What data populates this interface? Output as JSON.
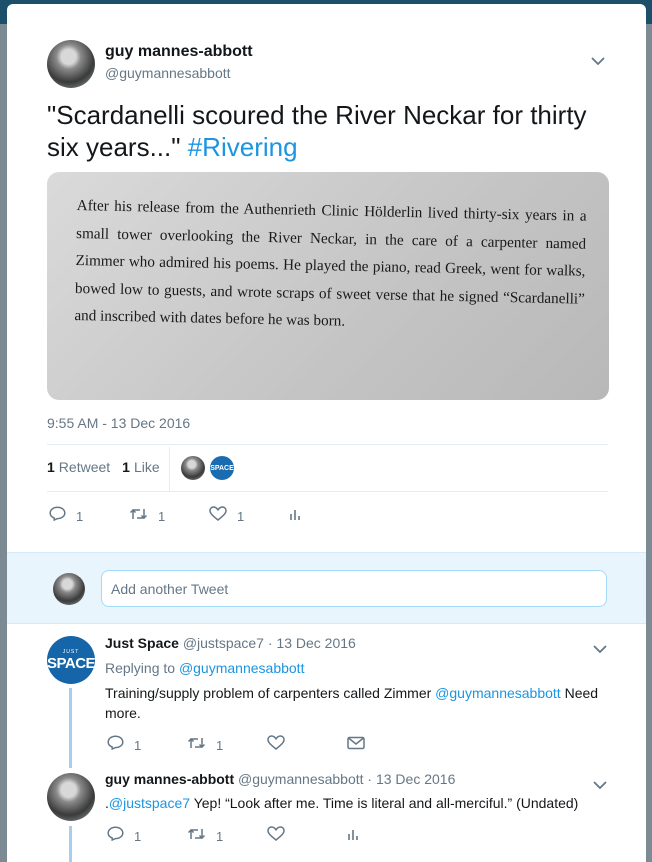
{
  "tweet": {
    "author_name": "guy mannes-abbott",
    "author_handle": "@guymannesabbott",
    "text": "\"Scardanelli scoured the River Neckar for thirty six years...\"",
    "hashtag": "#Rivering",
    "photo_text": "After his release from the Authenrieth Clinic Hölderlin lived thirty-six years in a small tower overlooking the River Neckar, in the care of a carpenter named Zimmer who admired his poems. He played the piano, read Greek, went for walks, bowed low to guests, and wrote scraps of sweet verse that he signed “Scardanelli” and inscribed with dates before he was born.",
    "timestamp": "9:55 AM - 13 Dec 2016",
    "retweet_count": "1",
    "retweet_label": "Retweet",
    "like_count": "1",
    "like_label": "Like",
    "reply_count": "1",
    "rt_action_count": "1",
    "like_action_count": "1",
    "liker_badge": "SPACE"
  },
  "reply_input": {
    "placeholder": "Add another Tweet"
  },
  "replies": [
    {
      "name": "Just Space",
      "handle": "@justspace7",
      "date": "· 13 Dec 2016",
      "replying_prefix": "Replying to",
      "replying_to": "@guymannesabbott",
      "text_before": "Training/supply problem of carpenters called Zimmer",
      "mention": "@guymannesabbott",
      "text_after": "Need",
      "text_line2": "more.",
      "reply_count": "1",
      "retweet_count": "1",
      "avatar_small": "JUST",
      "avatar_big": "SPACE"
    },
    {
      "name": "guy mannes-abbott",
      "handle": "@guymannesabbott",
      "date": "· 13 Dec 2016",
      "prefix": ".",
      "mention": "@justspace7",
      "text": "Yep! “Look after me. Time is literal and all-merciful.” (Undated)",
      "reply_count": "1",
      "retweet_count": "1"
    }
  ],
  "icons": {
    "reply": "reply-icon",
    "retweet": "retweet-icon",
    "like": "heart-icon",
    "analytics": "analytics-icon",
    "dm": "envelope-icon",
    "caret": "chevron-down-icon"
  }
}
